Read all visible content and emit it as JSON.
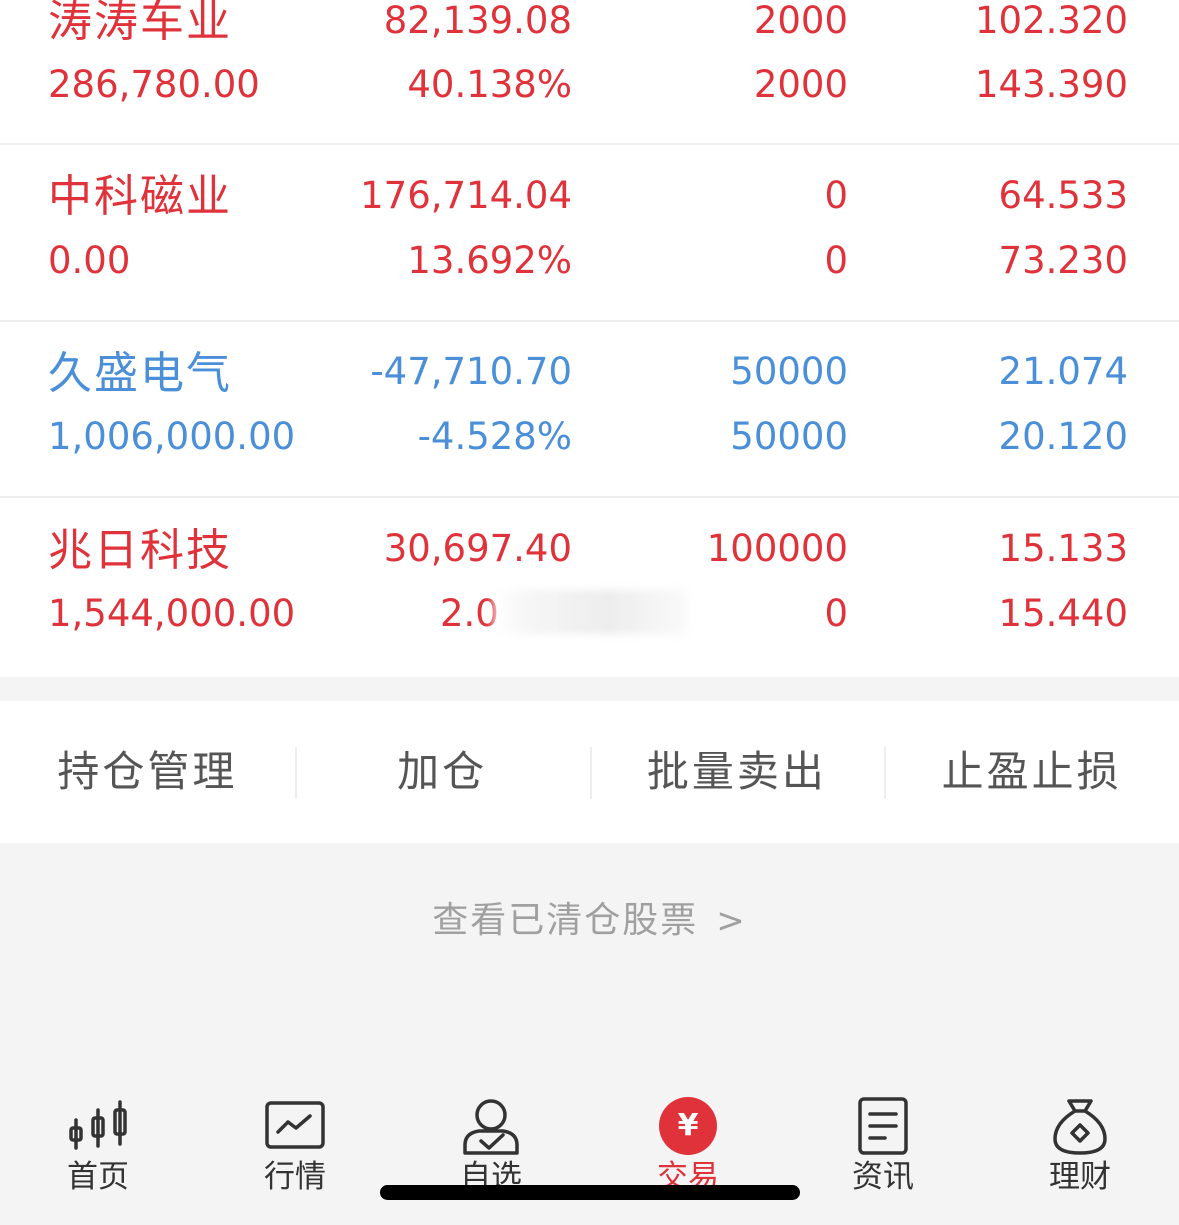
{
  "holdings": [
    {
      "name": "涛涛车业",
      "market_value": "286,780.00",
      "pnl": "82,139.08",
      "pnl_pct": "40.138%",
      "position": "2000",
      "available": "2000",
      "cost": "102.320",
      "price": "143.390",
      "trend": "up"
    },
    {
      "name": "中科磁业",
      "market_value": "0.00",
      "pnl": "176,714.04",
      "pnl_pct": "13.692%",
      "position": "0",
      "available": "0",
      "cost": "64.533",
      "price": "73.230",
      "trend": "up"
    },
    {
      "name": "久盛电气",
      "market_value": "1,006,000.00",
      "pnl": "-47,710.70",
      "pnl_pct": "-4.528%",
      "position": "50000",
      "available": "50000",
      "cost": "21.074",
      "price": "20.120",
      "trend": "down"
    },
    {
      "name": "兆日科技",
      "market_value": "1,544,000.00",
      "pnl": "30,697.40",
      "pnl_pct": "2.0",
      "position": "100000",
      "available": "0",
      "cost": "15.133",
      "price": "15.440",
      "trend": "up"
    }
  ],
  "actions": {
    "manage": "持仓管理",
    "add": "加仓",
    "batch_sell": "批量卖出",
    "stop": "止盈止损"
  },
  "cleared": {
    "label": "查看已清仓股票",
    "chevron": ">"
  },
  "tabs": [
    {
      "label": "首页",
      "icon": "candlestick-icon"
    },
    {
      "label": "行情",
      "icon": "trend-chart-icon"
    },
    {
      "label": "自选",
      "icon": "user-check-icon"
    },
    {
      "label": "交易",
      "icon": "yuan-icon",
      "glyph": "¥"
    },
    {
      "label": "资讯",
      "icon": "document-icon"
    },
    {
      "label": "理财",
      "icon": "money-bag-icon"
    }
  ],
  "colors": {
    "up": "#e0323a",
    "down": "#4a8fd8",
    "active_tab": "#e0323a"
  }
}
